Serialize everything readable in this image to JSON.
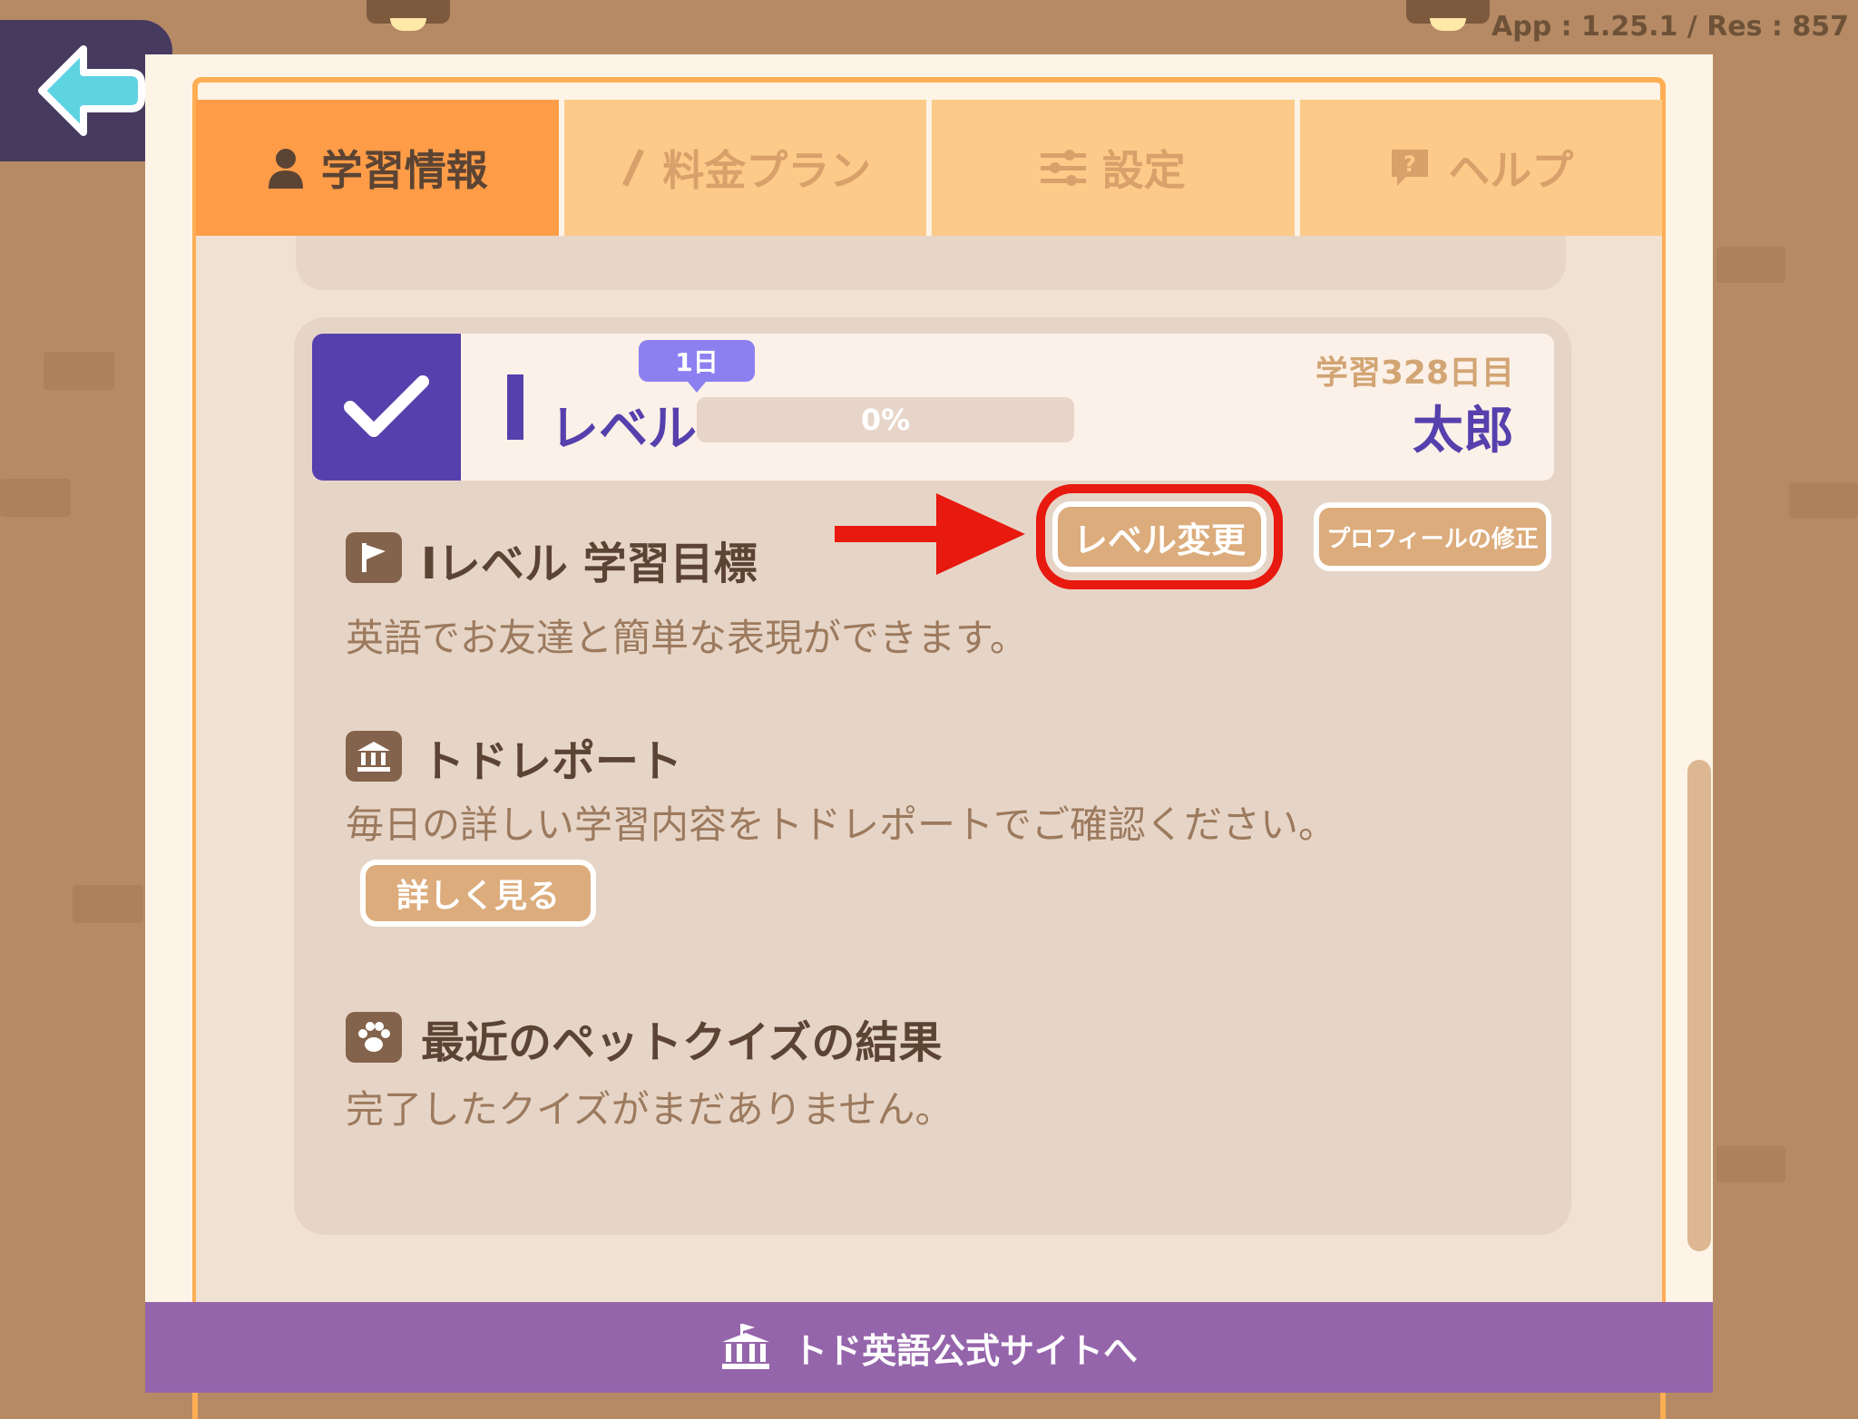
{
  "app_version": "App : 1.25.1 / Res : 857",
  "tabs": [
    {
      "label": "学習情報",
      "icon": "person-icon",
      "active": true
    },
    {
      "label": "料金プラン",
      "icon": "pencil-icon",
      "active": false
    },
    {
      "label": "設定",
      "icon": "sliders-icon",
      "active": false
    },
    {
      "label": "ヘルプ",
      "icon": "help-bubble-icon",
      "active": false
    }
  ],
  "profile": {
    "level_label": "レベル",
    "day_badge": "1日",
    "progress_text": "0%",
    "progress_value": 0,
    "study_days": "学習328日目",
    "username": "太郎"
  },
  "buttons": {
    "level_change": "レベル変更",
    "profile_edit": "プロフィールの修正",
    "view_details": "詳しく見る"
  },
  "sections": {
    "goal": {
      "title": "Iレベル 学習目標",
      "text": "英語でお友達と簡単な表現ができます。",
      "icon": "flag-icon"
    },
    "report": {
      "title": "トドレポート",
      "text": "毎日の詳しい学習内容をトドレポートでご確認ください。",
      "icon": "report-icon"
    },
    "quiz": {
      "title": "最近のペットクイズの結果",
      "text": "完了したクイズがまだありません。",
      "icon": "paw-icon"
    }
  },
  "footer": {
    "label": "トド英語公式サイトへ",
    "icon": "building-icon"
  },
  "colors": {
    "accent_purple": "#5640ad",
    "tab_active": "#ff9c47",
    "tab_inactive": "#fccb89",
    "button_tan": "#dcac7c",
    "footer_purple": "#9565ab",
    "highlight_red": "#e8190f"
  }
}
